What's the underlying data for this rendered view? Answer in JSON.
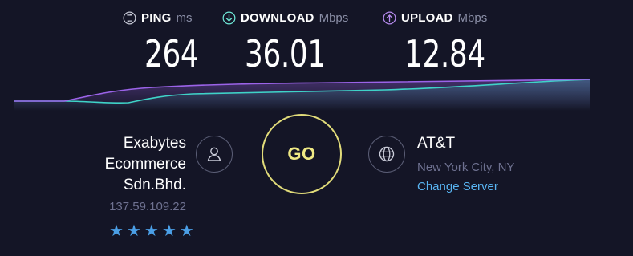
{
  "metrics": {
    "ping": {
      "label": "PING",
      "unit": "ms",
      "value": "264",
      "icon": "ping-icon",
      "color": "#c9cbd8"
    },
    "download": {
      "label": "DOWNLOAD",
      "unit": "Mbps",
      "value": "36.01",
      "icon": "download-arrow-icon",
      "color": "#6fe8d7"
    },
    "upload": {
      "label": "UPLOAD",
      "unit": "Mbps",
      "value": "12.84",
      "icon": "upload-arrow-icon",
      "color": "#b88cf0"
    }
  },
  "graph": {
    "download_color": "#3fd3c8",
    "upload_color": "#9b63e8"
  },
  "isp": {
    "name_line1": "Exabytes",
    "name_line2": "Ecommerce",
    "name_line3": "Sdn.Bhd.",
    "ip": "137.59.109.22",
    "rating_stars": 5,
    "star_glyphs": "★★★★★"
  },
  "go": {
    "label": "GO",
    "color": "#e2dc7a"
  },
  "server": {
    "name": "AT&T",
    "location": "New York City, NY",
    "change_label": "Change Server",
    "link_color": "#58b4f2"
  }
}
